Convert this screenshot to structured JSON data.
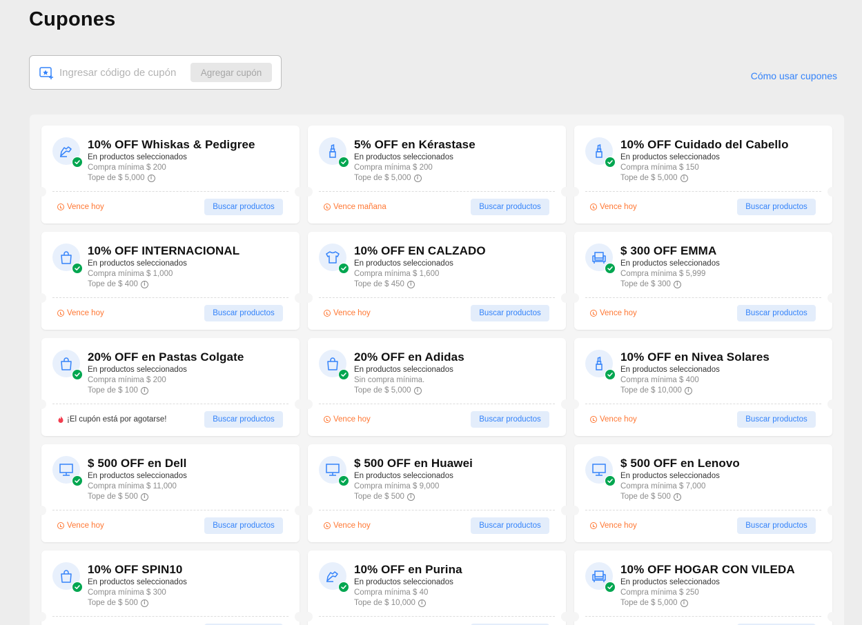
{
  "page": {
    "title": "Cupones"
  },
  "coupon_input": {
    "placeholder": "Ingresar código de cupón",
    "button_label": "Agregar cupón"
  },
  "help_link": "Cómo usar cupones",
  "search_button_label": "Buscar productos",
  "colors": {
    "accent": "#3483fa",
    "success": "#00a650",
    "warning": "#ff7733",
    "hot": "#f23d4f"
  },
  "coupons": [
    {
      "title": "10% OFF Whiskas & Pedigree",
      "subtitle": "En productos seleccionados",
      "minimum": "Compra mínima $ 200",
      "cap": "Tope de $ 5,000",
      "status": "Vence hoy",
      "status_type": "expiry",
      "icon": "pet-brush-icon"
    },
    {
      "title": "5% OFF en Kérastase",
      "subtitle": "En productos seleccionados",
      "minimum": "Compra mínima $ 200",
      "cap": "Tope de $ 5,000",
      "status": "Vence mañana",
      "status_type": "expiry",
      "icon": "lipstick-icon"
    },
    {
      "title": "10% OFF Cuidado del Cabello",
      "subtitle": "En productos seleccionados",
      "minimum": "Compra mínima $ 150",
      "cap": "Tope de $ 5,000",
      "status": "Vence hoy",
      "status_type": "expiry",
      "icon": "lipstick-icon"
    },
    {
      "title": "10% OFF INTERNACIONAL",
      "subtitle": "En productos seleccionados",
      "minimum": "Compra mínima $ 1,000",
      "cap": "Tope de $ 400",
      "status": "Vence hoy",
      "status_type": "expiry",
      "icon": "shopping-bag-icon"
    },
    {
      "title": "10% OFF EN CALZADO",
      "subtitle": "En productos seleccionados",
      "minimum": "Compra mínima $ 1,600",
      "cap": "Tope de $ 450",
      "status": "Vence hoy",
      "status_type": "expiry",
      "icon": "tshirt-icon"
    },
    {
      "title": "$ 300 OFF EMMA",
      "subtitle": "En productos seleccionados",
      "minimum": "Compra mínima $ 5,999",
      "cap": "Tope de $ 300",
      "status": "Vence hoy",
      "status_type": "expiry",
      "icon": "armchair-icon"
    },
    {
      "title": "20% OFF en Pastas Colgate",
      "subtitle": "En productos seleccionados",
      "minimum": "Compra mínima $ 200",
      "cap": "Tope de $ 100",
      "status": "¡El cupón está por agotarse!",
      "status_type": "hot",
      "icon": "shopping-bag-icon"
    },
    {
      "title": "20% OFF en Adidas",
      "subtitle": "En productos seleccionados",
      "minimum": "Sin compra mínima.",
      "cap": "Tope de $ 5,000",
      "status": "Vence hoy",
      "status_type": "expiry",
      "icon": "shopping-bag-icon"
    },
    {
      "title": "10% OFF en Nivea Solares",
      "subtitle": "En productos seleccionados",
      "minimum": "Compra mínima $ 400",
      "cap": "Tope de $ 10,000",
      "status": "Vence hoy",
      "status_type": "expiry",
      "icon": "lipstick-icon"
    },
    {
      "title": "$ 500 OFF en Dell",
      "subtitle": "En productos seleccionados",
      "minimum": "Compra mínima $ 11,000",
      "cap": "Tope de $ 500",
      "status": "Vence hoy",
      "status_type": "expiry",
      "icon": "monitor-icon"
    },
    {
      "title": "$ 500 OFF en Huawei",
      "subtitle": "En productos seleccionados",
      "minimum": "Compra mínima $ 9,000",
      "cap": "Tope de $ 500",
      "status": "Vence hoy",
      "status_type": "expiry",
      "icon": "monitor-icon"
    },
    {
      "title": "$ 500 OFF en Lenovo",
      "subtitle": "En productos seleccionados",
      "minimum": "Compra mínima $ 7,000",
      "cap": "Tope de $ 500",
      "status": "Vence hoy",
      "status_type": "expiry",
      "icon": "monitor-icon"
    },
    {
      "title": "10% OFF SPIN10",
      "subtitle": "En productos seleccionados",
      "minimum": "Compra mínima $ 300",
      "cap": "Tope de $ 500",
      "status": "",
      "status_type": "expiry",
      "icon": "shopping-bag-icon"
    },
    {
      "title": "10% OFF en Purina",
      "subtitle": "En productos seleccionados",
      "minimum": "Compra mínima $ 40",
      "cap": "Tope de $ 10,000",
      "status": "",
      "status_type": "expiry",
      "icon": "pet-brush-icon"
    },
    {
      "title": "10% OFF HOGAR CON VILEDA",
      "subtitle": "En productos seleccionados",
      "minimum": "Compra mínima $ 250",
      "cap": "Tope de $ 5,000",
      "status": "",
      "status_type": "expiry",
      "icon": "armchair-icon"
    }
  ]
}
